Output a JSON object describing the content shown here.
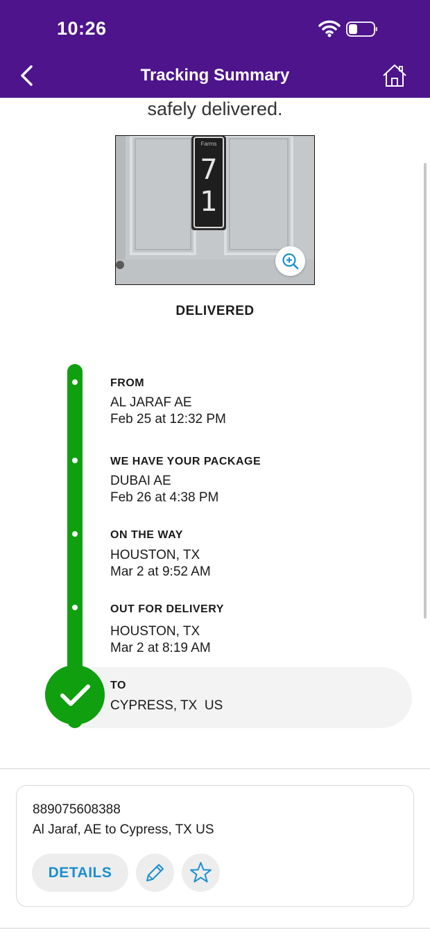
{
  "status_bar": {
    "time": "10:26"
  },
  "header": {
    "title": "Tracking Summary",
    "back_icon": "chevron-left-icon",
    "home_icon": "home-icon"
  },
  "delivery": {
    "message_fragment": "safely delivered.",
    "photo_label_top": "Farms",
    "photo_number_top": "7",
    "photo_number_bottom": "1",
    "status": "DELIVERED"
  },
  "timeline": {
    "color": "#0f9f0f",
    "steps": [
      {
        "label": "FROM",
        "location": "AL JARAF AE",
        "time": "Feb 25 at 12:32 PM"
      },
      {
        "label": "WE HAVE YOUR PACKAGE",
        "location": "DUBAI AE",
        "time": "Feb 26 at 4:38 PM"
      },
      {
        "label": "ON THE WAY",
        "location": "HOUSTON, TX",
        "time": "Mar 2 at 9:52 AM"
      },
      {
        "label": "OUT FOR DELIVERY",
        "location": "HOUSTON, TX",
        "time": "Mar 2 at 8:19 AM"
      },
      {
        "label": "TO",
        "location": "CYPRESS, TX  US"
      }
    ]
  },
  "shipment": {
    "tracking_number": "889075608388",
    "route": "Al Jaraf, AE to Cypress, TX US",
    "details_label": "DETAILS",
    "accent_color": "#1a8fd1"
  },
  "colors": {
    "header_bg": "#4d148c"
  }
}
